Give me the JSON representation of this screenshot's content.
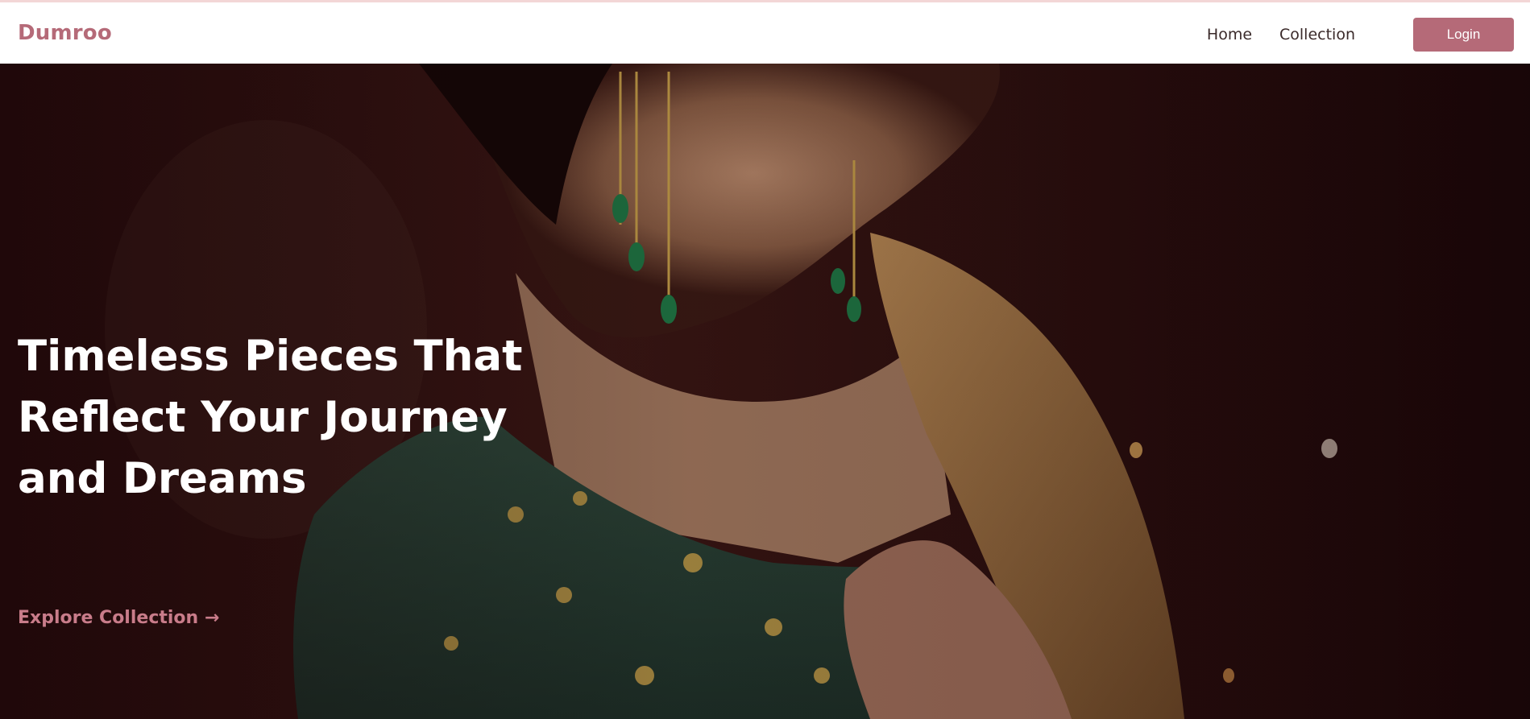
{
  "brand": {
    "name": "Dumroo",
    "color": "#b56a78"
  },
  "nav": {
    "links": [
      {
        "label": "Home"
      },
      {
        "label": "Collection"
      }
    ],
    "login_label": "Login"
  },
  "hero": {
    "title_lines": [
      "Timeless Pieces That",
      "Reflect Your Journey",
      "and Dreams"
    ],
    "cta_label": "Explore Collection →",
    "cta_color": "#c97c8a"
  },
  "icons": [
    "right-arrow-icon"
  ]
}
